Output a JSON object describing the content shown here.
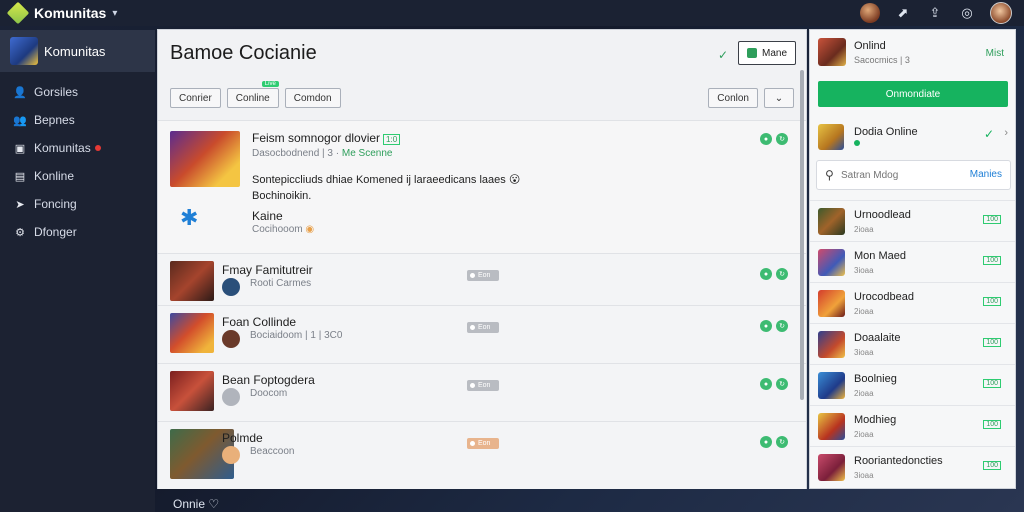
{
  "app": {
    "name": "Komunitas"
  },
  "sidebar": {
    "header": "Komunitas",
    "items": [
      {
        "icon": "user-icon",
        "glyph": "👤",
        "label": "Gorsiles"
      },
      {
        "icon": "people-icon",
        "glyph": "👥",
        "label": "Bepnes"
      },
      {
        "icon": "book-icon",
        "glyph": "▣",
        "label": "Komunitas",
        "alert": true
      },
      {
        "icon": "document-icon",
        "glyph": "▤",
        "label": "Konline"
      },
      {
        "icon": "tag-icon",
        "glyph": "➤",
        "label": "Foncing"
      },
      {
        "icon": "gear-icon",
        "glyph": "⚙",
        "label": "Dfonger"
      }
    ]
  },
  "main": {
    "title": "Bamoe Cocianie",
    "header_button": "Mane",
    "filters": [
      "Conrier",
      "Conline",
      "Comdon"
    ],
    "filters_badge": "Live",
    "right_filter": "Conlon",
    "rows": [
      {
        "title": "Feism somnogor dlovier",
        "tag": "1:0",
        "sub": "Dasocbodnend | 3 ·",
        "sub_green": "Me Scenne",
        "body1": "Sontepiccliuds dhiae Komened ij laraeedicans laaes",
        "body2": "Bochinoikin.",
        "user_name": "Kaine",
        "user_sub": "Cocihooom"
      },
      {
        "title": "Fmay Famitutreir",
        "sub": "Rooti Carmes",
        "pill": "Eon"
      },
      {
        "title": "Foan Collinde",
        "sub": "Bociaidoom | 1 | 3C0",
        "pill": "Eon"
      },
      {
        "title": "Bean Foptogdera",
        "sub": "Doocom",
        "pill": "Eon"
      },
      {
        "title": "Polmde",
        "sub": "Beaccoon",
        "pill": "Eon"
      }
    ]
  },
  "right": {
    "profile_name": "Onlind",
    "profile_sub": "Sacocmics | 3",
    "profile_action": "Mist",
    "primary_button": "Onmondiate",
    "status_name": "Dodia Online",
    "search_placeholder": "Satran Mdog",
    "search_button": "Manies",
    "friends": [
      {
        "name": "Urnoodlead",
        "sub": "2ioaa",
        "tag": "100"
      },
      {
        "name": "Mon Maed",
        "sub": "3ioaa",
        "tag": "100"
      },
      {
        "name": "Urocodbead",
        "sub": "2ioaa",
        "tag": "100"
      },
      {
        "name": "Doaalaite",
        "sub": "3ioaa",
        "tag": "100"
      },
      {
        "name": "Boolnieg",
        "sub": "2ioaa",
        "tag": "100"
      },
      {
        "name": "Modhieg",
        "sub": "2ioaa",
        "tag": "100"
      },
      {
        "name": "Rooriantedoncties",
        "sub": "3ioaa",
        "tag": "100"
      }
    ]
  },
  "footer": {
    "label": "Onnie"
  }
}
